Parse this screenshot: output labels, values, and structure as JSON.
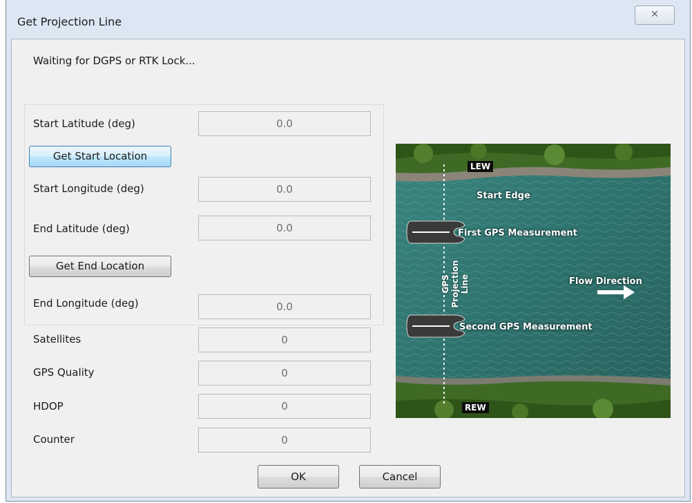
{
  "window": {
    "title": "Get Projection Line",
    "close_glyph": "✕"
  },
  "status_text": "Waiting for DGPS or RTK Lock...",
  "group": {
    "start_latitude": {
      "label": "Start Latitude (deg)",
      "value": "0.0"
    },
    "get_start_button": "Get Start Location",
    "start_longitude": {
      "label": "Start Longitude (deg)",
      "value": "0.0"
    },
    "end_latitude": {
      "label": "End Latitude (deg)",
      "value": "0.0"
    },
    "get_end_button": "Get End Location",
    "end_longitude": {
      "label": "End Longitude (deg)",
      "value": "0.0"
    }
  },
  "info": {
    "satellites": {
      "label": "Satellites",
      "value": "0"
    },
    "gps_quality": {
      "label": "GPS Quality",
      "value": "0"
    },
    "hdop": {
      "label": "HDOP",
      "value": "0"
    },
    "counter": {
      "label": "Counter",
      "value": "0"
    }
  },
  "buttons": {
    "ok": "OK",
    "cancel": "Cancel"
  },
  "diagram": {
    "lew": "LEW",
    "rew": "REW",
    "start_edge": "Start Edge",
    "first_measurement": "First GPS Measurement",
    "second_measurement": "Second GPS Measurement",
    "projection_line_1": "GPS",
    "projection_line_2": "Projection",
    "projection_line_3": "Line",
    "flow_direction": "Flow Direction"
  },
  "colors": {
    "active_button": "#bee6fd",
    "water": "#2f6f6b",
    "vegetation": "#3f6a25"
  },
  "icons": {
    "close": "close-icon",
    "boat": "boat-icon",
    "arrow": "arrow-right-icon"
  }
}
